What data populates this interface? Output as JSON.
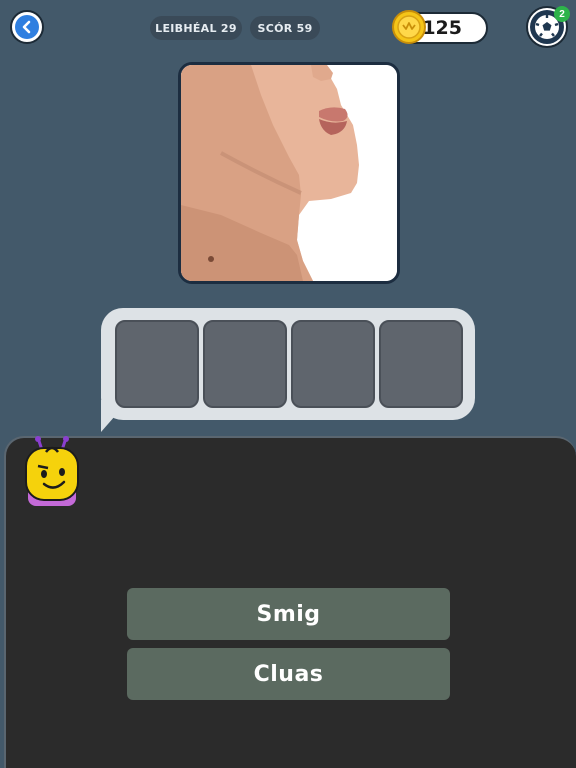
{
  "header": {
    "level_label": "LEIBHÉAL 29",
    "score_label": "SCÓR 59",
    "coin_count": "125",
    "notification_count": "2"
  },
  "icons": {
    "back": "back-arrow-icon",
    "coin": "coin-icon",
    "settings": "soccer-ball-icon",
    "mascot": "mascot-icon"
  },
  "puzzle": {
    "image_subject": "photo-neck",
    "slots": [
      "",
      "",
      "",
      ""
    ]
  },
  "answers": [
    {
      "label": "Smig"
    },
    {
      "label": "Cluas"
    }
  ],
  "colors": {
    "background": "#43596a",
    "panel": "#2b2b2b",
    "answer_button": "#5b6a60",
    "slot": "#5f656d",
    "bubble": "#dde2e6",
    "accent_blue": "#2f7fe0",
    "coin_gold": "#f5c518",
    "badge_green": "#2db34a"
  }
}
